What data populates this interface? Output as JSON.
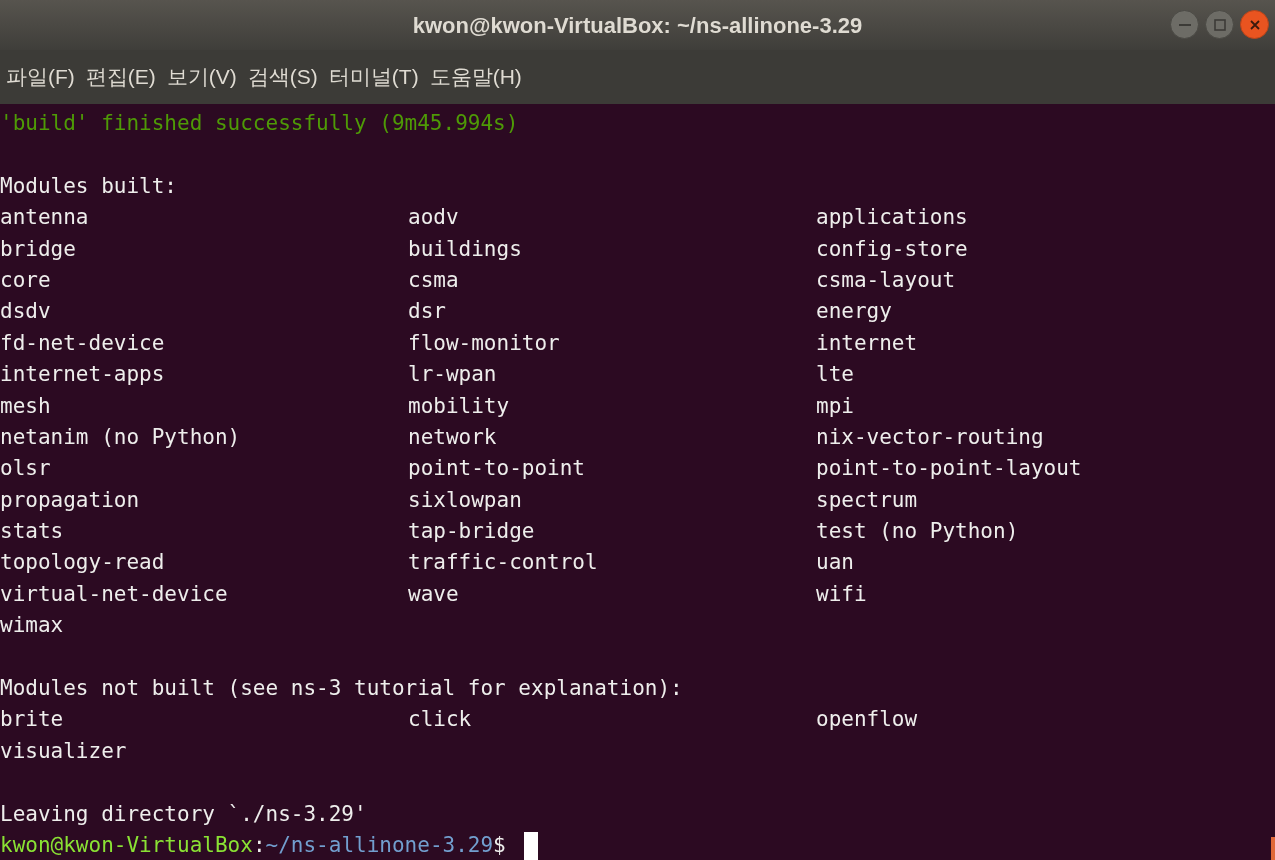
{
  "window": {
    "title": "kwon@kwon-VirtualBox: ~/ns-allinone-3.29"
  },
  "menu": [
    "파일(F)",
    "편집(E)",
    "보기(V)",
    "검색(S)",
    "터미널(T)",
    "도움말(H)"
  ],
  "terminal": {
    "lines": [
      {
        "kind": "success",
        "text": "'build' finished successfully (9m45.994s)"
      },
      {
        "kind": "blank"
      },
      {
        "kind": "text",
        "text": "Modules built:"
      },
      {
        "kind": "columns",
        "cells": [
          "antenna",
          "aodv",
          "applications"
        ]
      },
      {
        "kind": "columns",
        "cells": [
          "bridge",
          "buildings",
          "config-store"
        ]
      },
      {
        "kind": "columns",
        "cells": [
          "core",
          "csma",
          "csma-layout"
        ]
      },
      {
        "kind": "columns",
        "cells": [
          "dsdv",
          "dsr",
          "energy"
        ]
      },
      {
        "kind": "columns",
        "cells": [
          "fd-net-device",
          "flow-monitor",
          "internet"
        ]
      },
      {
        "kind": "columns",
        "cells": [
          "internet-apps",
          "lr-wpan",
          "lte"
        ]
      },
      {
        "kind": "columns",
        "cells": [
          "mesh",
          "mobility",
          "mpi"
        ]
      },
      {
        "kind": "columns",
        "cells": [
          "netanim (no Python)",
          "network",
          "nix-vector-routing"
        ]
      },
      {
        "kind": "columns",
        "cells": [
          "olsr",
          "point-to-point",
          "point-to-point-layout"
        ]
      },
      {
        "kind": "columns",
        "cells": [
          "propagation",
          "sixlowpan",
          "spectrum"
        ]
      },
      {
        "kind": "columns",
        "cells": [
          "stats",
          "tap-bridge",
          "test (no Python)"
        ]
      },
      {
        "kind": "columns",
        "cells": [
          "topology-read",
          "traffic-control",
          "uan"
        ]
      },
      {
        "kind": "columns",
        "cells": [
          "virtual-net-device",
          "wave",
          "wifi"
        ]
      },
      {
        "kind": "columns",
        "cells": [
          "wimax"
        ]
      },
      {
        "kind": "blank"
      },
      {
        "kind": "text",
        "text": "Modules not built (see ns-3 tutorial for explanation):"
      },
      {
        "kind": "columns",
        "cells": [
          "brite",
          "click",
          "openflow"
        ]
      },
      {
        "kind": "columns",
        "cells": [
          "visualizer"
        ]
      },
      {
        "kind": "blank"
      },
      {
        "kind": "text",
        "text": "Leaving directory `./ns-3.29'"
      },
      {
        "kind": "prompt",
        "user_host": "kwon@kwon-VirtualBox",
        "separator": ":",
        "path": "~/ns-allinone-3.29",
        "symbol": "$"
      }
    ]
  }
}
